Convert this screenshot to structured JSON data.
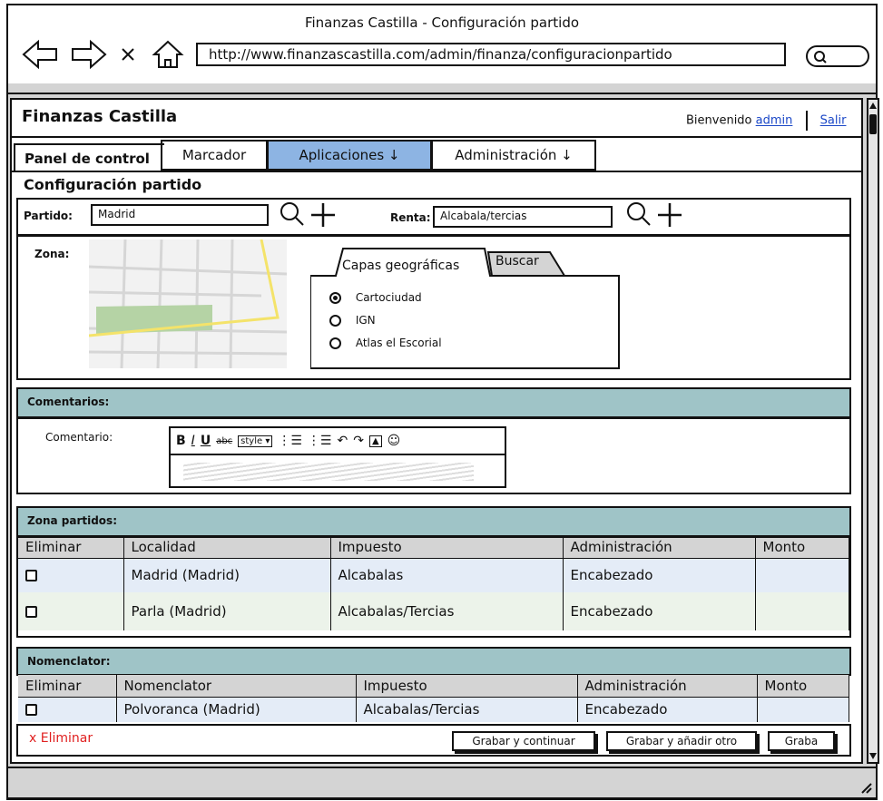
{
  "window": {
    "title": "Finanzas Castilla - Configuración partido",
    "url": "http://www.finanzascastilla.com/admin/finanza/configuracionpartido"
  },
  "nav_icons": [
    "arrow-left-icon",
    "arrow-right-icon",
    "close-icon",
    "home-icon",
    "search-icon"
  ],
  "header": {
    "app_title": "Finanzas Castilla",
    "welcome": "Bienvenido",
    "user_link": "admin",
    "logout_link": "Salir"
  },
  "tabs": {
    "panel": "Panel de control",
    "marcador": "Marcador",
    "aplicaciones": "Aplicaciones ↓",
    "administracion": "Administración ↓"
  },
  "form": {
    "section_title": "Configuración partido",
    "partido_label": "Partido:",
    "partido_value": "Madrid",
    "renta_label": "Renta:",
    "renta_value": "Alcabala/tercias",
    "zona_label": "Zona:",
    "map_tabs": [
      "Capas geográficas",
      "Buscar"
    ],
    "layers": [
      {
        "label": "Cartociudad",
        "selected": true
      },
      {
        "label": "IGN",
        "selected": false
      },
      {
        "label": "Atlas el Escorial",
        "selected": false
      }
    ]
  },
  "comments": {
    "header": "Comentarios:",
    "label": "Comentario:",
    "toolbar_style": "style"
  },
  "zona_partidos": {
    "header": "Zona partidos:",
    "columns": [
      "Eliminar",
      "Localidad",
      "Impuesto",
      "Administración",
      "Monto"
    ],
    "rows": [
      {
        "localidad": "Madrid (Madrid)",
        "impuesto": "Alcabalas",
        "administracion": "Encabezado",
        "monto": ""
      },
      {
        "localidad": "Parla (Madrid)",
        "impuesto": "Alcabalas/Tercias",
        "administracion": "Encabezado",
        "monto": ""
      }
    ]
  },
  "nomenclator": {
    "header": "Nomenclator:",
    "columns": [
      "Eliminar",
      "Nomenclator",
      "Impuesto",
      "Administración",
      "Monto"
    ],
    "rows": [
      {
        "nomenclator": "Polvoranca (Madrid)",
        "impuesto": "Alcabalas/Tercias",
        "administracion": "Encabezado",
        "monto": ""
      }
    ]
  },
  "footer": {
    "delete": "x Eliminar",
    "save_continue": "Grabar y continuar",
    "save_add": "Grabar y añadir otro",
    "save": "Graba"
  },
  "colors": {
    "active_tab": "#8db4e3",
    "section_header": "#9fc4c7",
    "delete_text": "#e02020",
    "link": "#1a47c7"
  }
}
